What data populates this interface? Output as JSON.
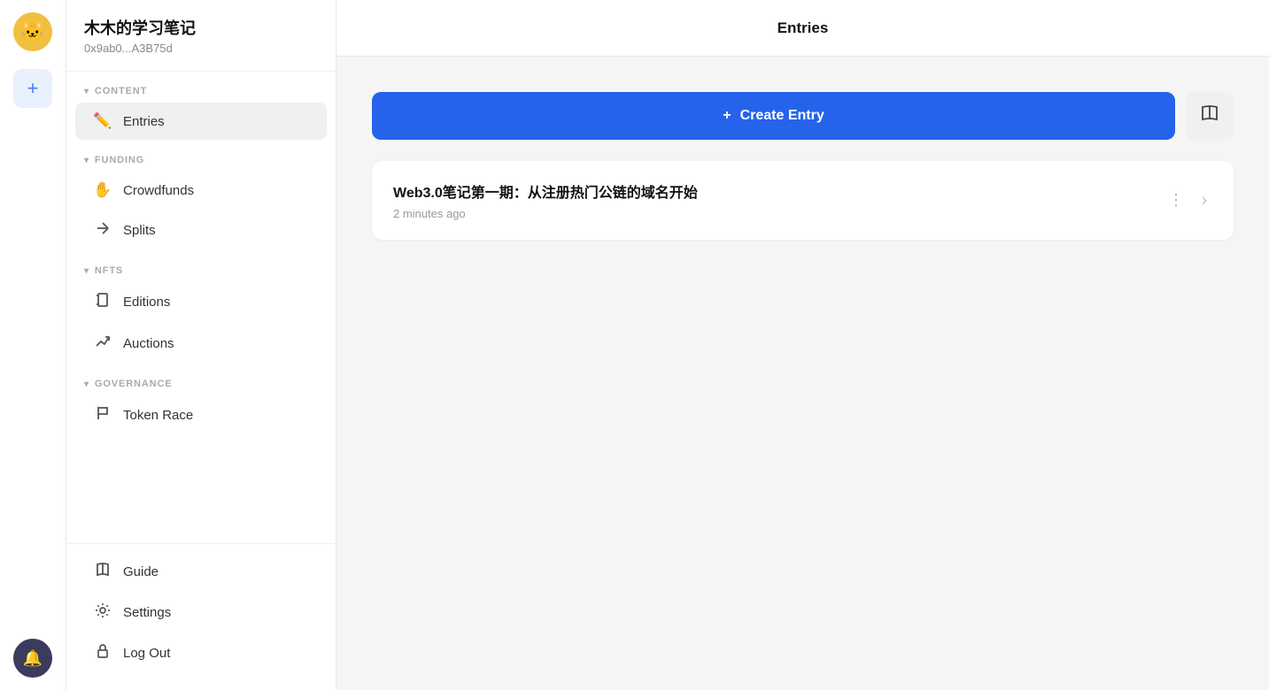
{
  "rail": {
    "add_label": "+",
    "bell_icon": "🔔",
    "avatar_emoji": "🐱"
  },
  "sidebar": {
    "user_name": "木木的学习笔记",
    "user_address": "0x9ab0...A3B75d",
    "sections": [
      {
        "id": "content",
        "label": "CONTENT",
        "items": [
          {
            "id": "entries",
            "label": "Entries",
            "icon": "✏️",
            "active": true
          }
        ]
      },
      {
        "id": "funding",
        "label": "FUNDING",
        "items": [
          {
            "id": "crowdfunds",
            "label": "Crowdfunds",
            "icon": "✋"
          },
          {
            "id": "splits",
            "label": "Splits",
            "icon": "↗"
          }
        ]
      },
      {
        "id": "nfts",
        "label": "NFTS",
        "items": [
          {
            "id": "editions",
            "label": "Editions",
            "icon": "📋"
          },
          {
            "id": "auctions",
            "label": "Auctions",
            "icon": "📈"
          }
        ]
      },
      {
        "id": "governance",
        "label": "GOVERNANCE",
        "items": [
          {
            "id": "token-race",
            "label": "Token Race",
            "icon": "🚩"
          }
        ]
      }
    ],
    "bottom_items": [
      {
        "id": "guide",
        "label": "Guide",
        "icon": "📖"
      },
      {
        "id": "settings",
        "label": "Settings",
        "icon": "⚙️"
      },
      {
        "id": "logout",
        "label": "Log Out",
        "icon": "🔒"
      }
    ]
  },
  "main": {
    "title": "Entries",
    "create_entry_label": "Create Entry",
    "create_entry_plus": "+",
    "book_icon": "📖",
    "entries": [
      {
        "id": "entry-1",
        "title": "Web3.0笔记第一期：从注册热门公链的域名开始",
        "time": "2 minutes ago"
      }
    ]
  }
}
